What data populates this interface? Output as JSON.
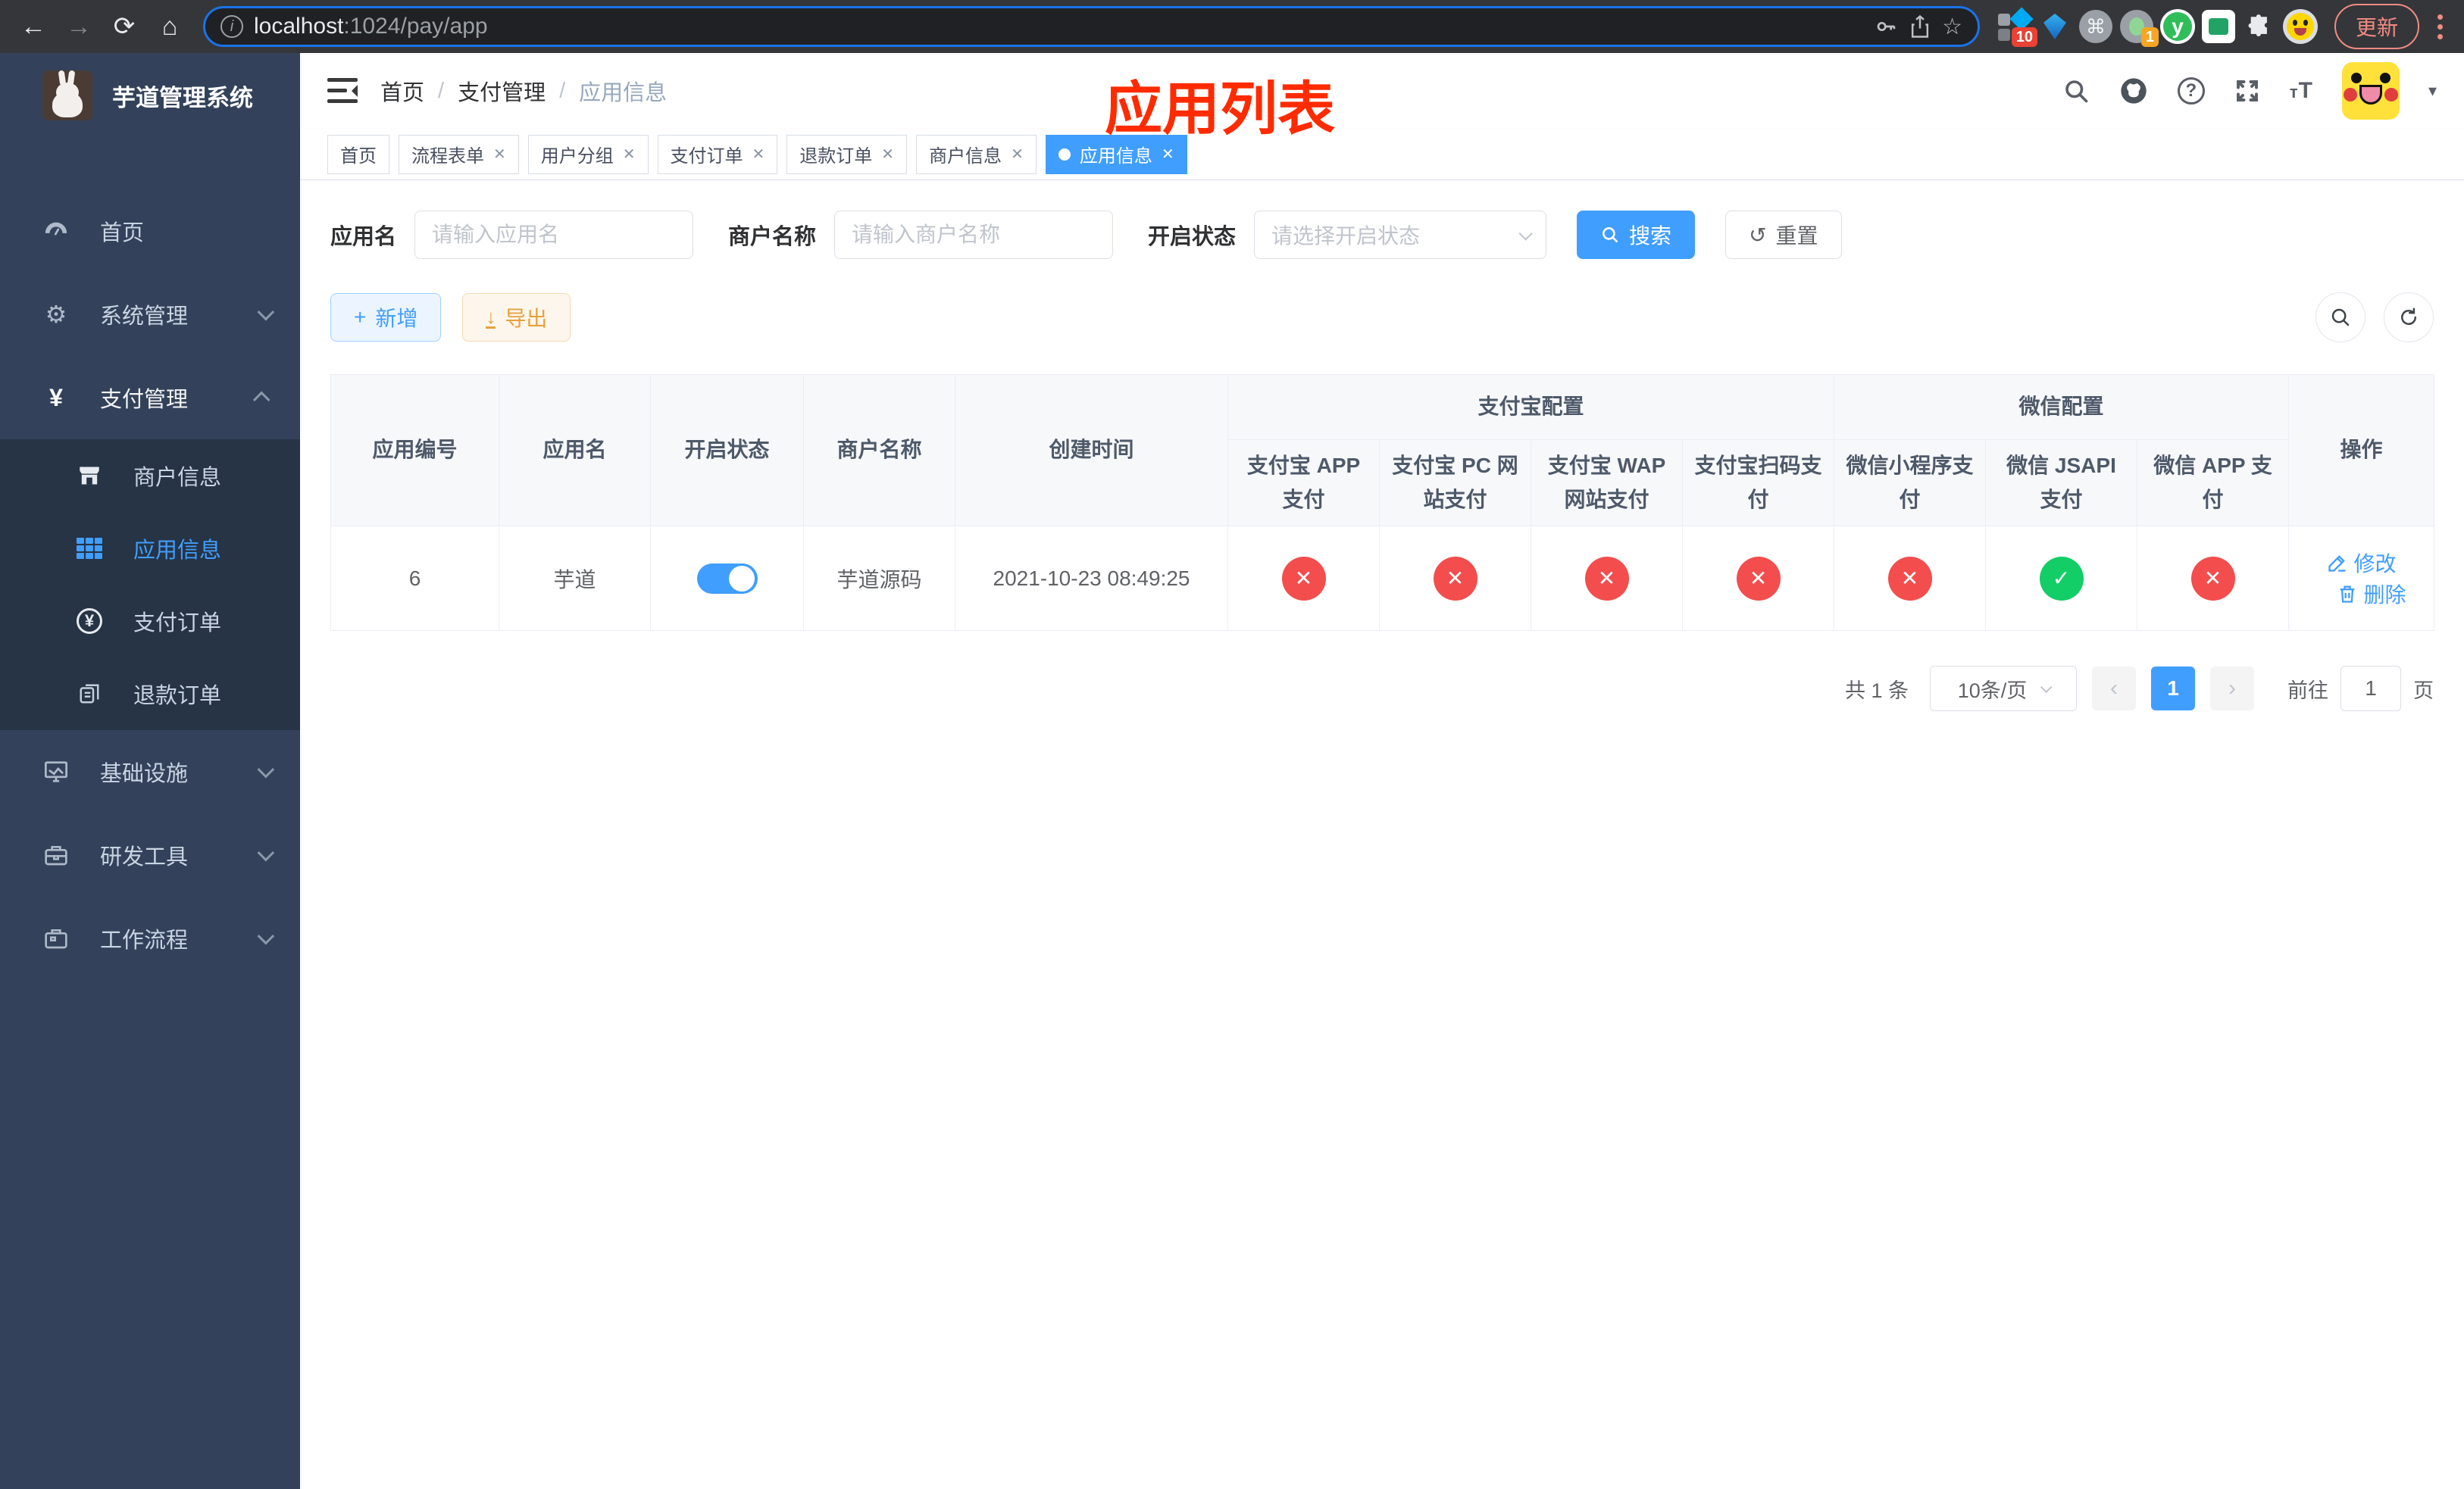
{
  "browser": {
    "url_host": "localhost",
    "url_rest": ":1024/pay/app",
    "update_label": "更新",
    "ext_badge_10": "10",
    "ext_badge_1": "1",
    "ext_y": "y",
    "cmd_glyph": "⌘"
  },
  "icons": {
    "back": "←",
    "forward": "→",
    "reload": "⟳",
    "home": "⌂",
    "info": "i",
    "star": "☆",
    "question": "?",
    "caret": "▾",
    "check": "✓",
    "cross": "✕",
    "prev": "‹",
    "next": "›",
    "plus": "+",
    "download": "↓",
    "reset": "↺",
    "select_chevron": "",
    "yen": "¥"
  },
  "sidebar": {
    "title": "芋道管理系统",
    "items": [
      {
        "label": "首页"
      },
      {
        "label": "系统管理"
      },
      {
        "label": "支付管理"
      },
      {
        "label": "商户信息"
      },
      {
        "label": "应用信息"
      },
      {
        "label": "支付订单"
      },
      {
        "label": "退款订单"
      },
      {
        "label": "基础设施"
      },
      {
        "label": "研发工具"
      },
      {
        "label": "工作流程"
      }
    ]
  },
  "navbar": {
    "breadcrumb": [
      "首页",
      "支付管理",
      "应用信息"
    ],
    "separator": "/",
    "annotation": "应用列表"
  },
  "tabs": [
    {
      "label": "首页"
    },
    {
      "label": "流程表单"
    },
    {
      "label": "用户分组"
    },
    {
      "label": "支付订单"
    },
    {
      "label": "退款订单"
    },
    {
      "label": "商户信息"
    },
    {
      "label": "应用信息"
    }
  ],
  "filters": {
    "app_name_label": "应用名",
    "app_name_placeholder": "请输入应用名",
    "merchant_label": "商户名称",
    "merchant_placeholder": "请输入商户名称",
    "status_label": "开启状态",
    "status_placeholder": "请选择开启状态",
    "search_label": "搜索",
    "reset_label": "重置"
  },
  "toolbar": {
    "add_label": "新增",
    "export_label": "导出"
  },
  "table": {
    "group_alipay": "支付宝配置",
    "group_wechat": "微信配置",
    "columns": [
      "应用编号",
      "应用名",
      "开启状态",
      "商户名称",
      "创建时间",
      "支付宝 APP 支付",
      "支付宝 PC 网站支付",
      "支付宝 WAP 网站支付",
      "支付宝扫码支付",
      "微信小程序支付",
      "微信 JSAPI 支付",
      "微信 APP 支付",
      "操作"
    ],
    "row": {
      "id": "6",
      "name": "芋道",
      "enabled": true,
      "merchant": "芋道源码",
      "created_at": "2021-10-23 08:49:25",
      "statuses": [
        false,
        false,
        false,
        false,
        false,
        true,
        false
      ],
      "edit_label": "修改",
      "delete_label": "删除"
    }
  },
  "pagination": {
    "total": "共 1 条",
    "page_size": "10条/页",
    "page": "1",
    "goto_label": "前往",
    "goto_value": "1",
    "page_suffix": "页"
  },
  "colors": {
    "primary": "#409eff",
    "success": "#13ce66",
    "danger": "#f34d4d",
    "warning": "#e6a23c",
    "sidebar_bg": "#33425a",
    "submenu_bg": "#263445",
    "annotation_red": "#ff2b00"
  }
}
